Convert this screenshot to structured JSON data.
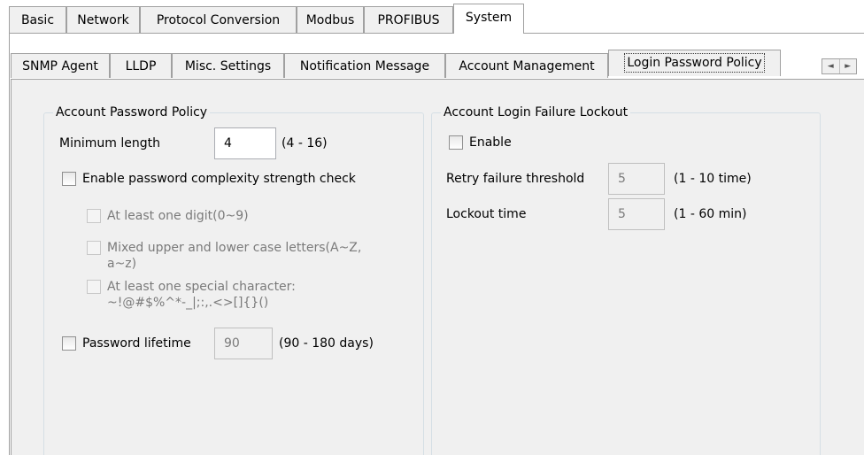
{
  "main_tabs": [
    "Basic",
    "Network",
    "Protocol Conversion",
    "Modbus",
    "PROFIBUS",
    "System"
  ],
  "sub_tabs": [
    "SNMP Agent",
    "LLDP",
    "Misc. Settings",
    "Notification Message",
    "Account Management",
    "Login Password Policy"
  ],
  "password_policy": {
    "title": "Account Password Policy",
    "min_length_label": "Minimum length",
    "min_length_value": "4",
    "min_length_range": "(4 - 16)",
    "complexity_label": "Enable password complexity strength check",
    "digit_label": "At least one digit(0~9)",
    "mixed_case_line1": "Mixed upper and lower case letters(A~Z,",
    "mixed_case_line2": "a~z)",
    "special_line1": "At least one special character:",
    "special_line2": "~!@#$%^*-_|;:,.<>[]{}()",
    "lifetime_label": "Password lifetime",
    "lifetime_value": "90",
    "lifetime_range": "(90 - 180 days)"
  },
  "lockout": {
    "title": "Account Login Failure Lockout",
    "enable_label": "Enable",
    "retry_label": "Retry failure threshold",
    "retry_value": "5",
    "retry_range": "(1 - 10 time)",
    "lockout_label": "Lockout time",
    "lockout_value": "5",
    "lockout_range": "(1 - 60 min)"
  },
  "icons": {
    "scroll_left": "◄",
    "scroll_right": "►"
  }
}
